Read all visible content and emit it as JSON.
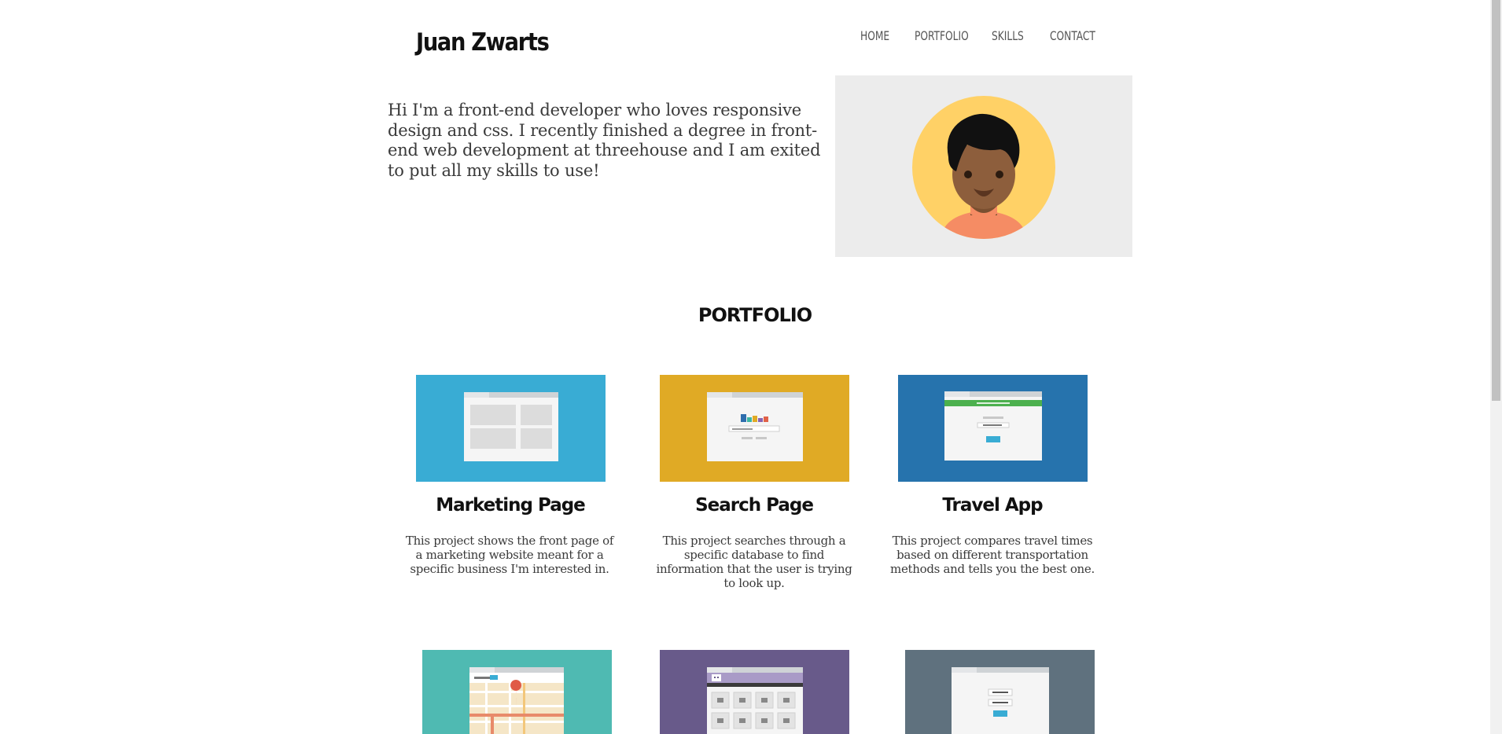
{
  "header": {
    "logo": "Juan Zwarts",
    "nav": [
      "HOME",
      "PORTFOLIO",
      "SKILLS",
      "CONTACT"
    ]
  },
  "intro": {
    "text": "Hi I'm a front-end developer who loves responsive design and css. I recently finished a degree in front-end web development at threehouse and I am exited to put all my skills to use!"
  },
  "avatar": {
    "icon": "person-avatar-icon",
    "bg": "#ffd166"
  },
  "portfolio": {
    "title": "PORTFOLIO",
    "projects": [
      {
        "title": "Marketing Page",
        "desc": "This project shows the front page of a marketing website meant for a specific business I'm interested in.",
        "color": "#39acd4",
        "icon": "marketing-page-thumbnail"
      },
      {
        "title": "Search Page",
        "desc": "This project searches through a specific database to find information that the user is trying to look up.",
        "color": "#e0aa25",
        "icon": "search-page-thumbnail"
      },
      {
        "title": "Travel App",
        "desc": "This project compares travel times based on different transportation methods and tells you the best one.",
        "color": "#2673ad",
        "icon": "travel-app-thumbnail"
      },
      {
        "title": "",
        "desc": "",
        "color": "#4fbab2",
        "icon": "map-app-thumbnail"
      },
      {
        "title": "",
        "desc": "",
        "color": "#685a8a",
        "icon": "photo-gallery-thumbnail"
      },
      {
        "title": "",
        "desc": "",
        "color": "#5f717e",
        "icon": "login-page-thumbnail"
      }
    ]
  }
}
